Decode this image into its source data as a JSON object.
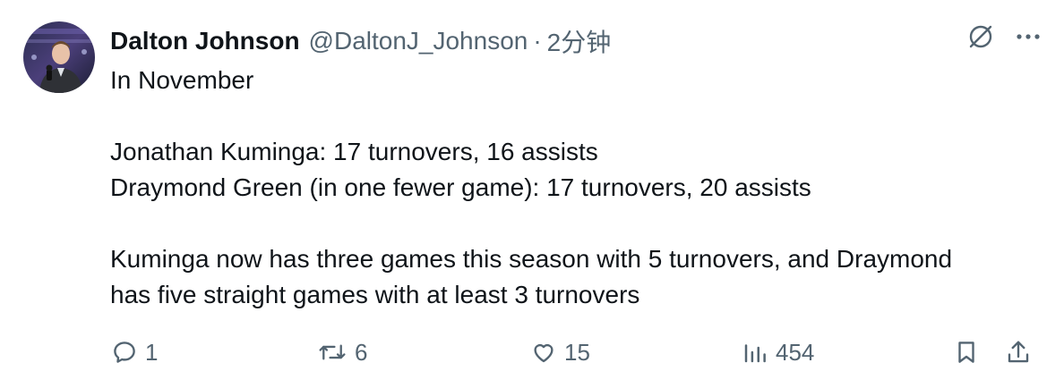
{
  "tweet": {
    "author_name": "Dalton Johnson",
    "author_handle": "@DaltonJ_Johnson",
    "separator": "·",
    "time_ago": "2分钟",
    "lines": {
      "l1": "In November",
      "l2": "Jonathan Kuminga: 17 turnovers, 16 assists",
      "l3": "Draymond Green (in one fewer game): 17 turnovers, 20 assists",
      "l4": "Kuminga now has three games this season with 5 turnovers, and Draymond",
      "l5": "has five straight games with at least 3 turnovers"
    },
    "stats": {
      "replies": "1",
      "reposts": "6",
      "likes": "15",
      "views": "454"
    }
  },
  "icons": {
    "top": [
      "grok-icon",
      "more-icon"
    ],
    "actions": [
      "reply-icon",
      "repost-icon",
      "like-icon",
      "views-icon",
      "bookmark-icon",
      "share-icon"
    ]
  },
  "colors": {
    "text": "#0f1419",
    "secondary": "#536471",
    "background": "#ffffff"
  }
}
